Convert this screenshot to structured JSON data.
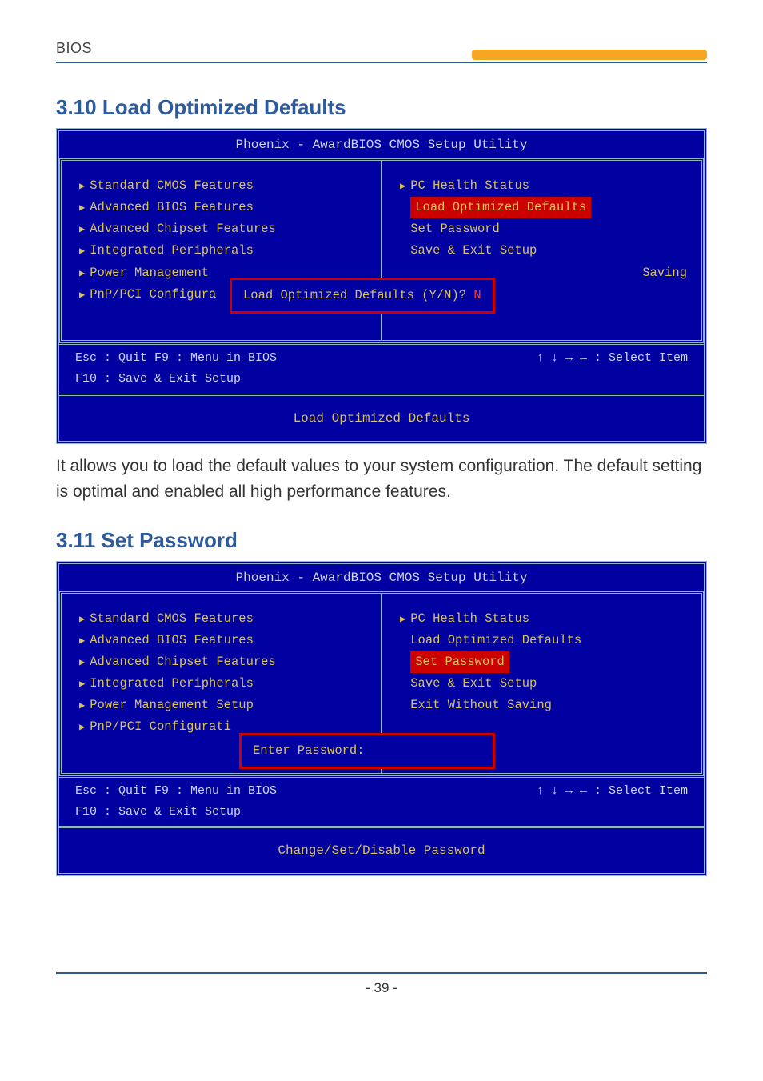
{
  "page": {
    "header_label": "BIOS",
    "footer": "- 39 -"
  },
  "section1": {
    "title": "3.10 Load Optimized Defaults",
    "body": "It allows you to load the default values to your system configuration. The default setting is optimal and enabled all high performance features."
  },
  "section2": {
    "title": "3.11 Set Password"
  },
  "bios_common": {
    "title": "Phoenix - AwardBIOS CMOS Setup Utility",
    "foot_left_line1": "Esc : Quit    F9 : Menu in BIOS",
    "foot_left_line2": "F10 : Save & Exit Setup",
    "foot_right": "↑ ↓ → ←   : Select Item"
  },
  "bios1": {
    "left": [
      "Standard CMOS Features",
      "Advanced BIOS Features",
      "Advanced Chipset Features",
      "Integrated Peripherals",
      "Power Management",
      "PnP/PCI Configura"
    ],
    "right": {
      "pc_health": "PC Health Status",
      "load_opt": "Load Optimized Defaults",
      "set_pwd": "Set Password",
      "save_exit": "Save & Exit Setup",
      "saving_frag": "Saving"
    },
    "dialog": "Load Optimized Defaults (Y/N)? ",
    "dialog_answer": "N",
    "desc": "Load Optimized Defaults"
  },
  "bios2": {
    "left": [
      "Standard CMOS Features",
      "Advanced BIOS Features",
      "Advanced Chipset Features",
      "Integrated Peripherals",
      "Power Management Setup",
      "PnP/PCI Configurati"
    ],
    "right": {
      "pc_health": "PC Health Status",
      "load_opt": "Load Optimized Defaults",
      "set_pwd": "Set Password",
      "save_exit": "Save & Exit Setup",
      "exit_no_save": "Exit Without Saving"
    },
    "dialog": "Enter Password:",
    "desc": "Change/Set/Disable Password"
  }
}
